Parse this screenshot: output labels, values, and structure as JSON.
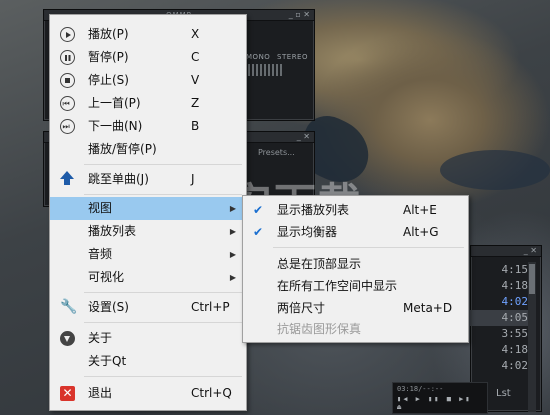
{
  "main_window": {
    "title": "QMMP",
    "mono_label": "MONO",
    "stereo_label": "STEREO"
  },
  "equalizer": {
    "presets_label": "Presets"
  },
  "playlist": {
    "durations": [
      "4:15",
      "4:18",
      "4:02",
      "4:05",
      "3:55",
      "4:18",
      "4:02"
    ],
    "active_index": 2,
    "selected_index": 3,
    "lst_label": "Lst"
  },
  "mini_player": {
    "time": "03:18/--:--",
    "controls": "▮◀ ▶ ▮▮ ■ ▶▮ ⏏"
  },
  "watermark": {
    "text": "安下载"
  },
  "context_menu": {
    "items": [
      {
        "label": "播放(P)",
        "shortcut": "X",
        "icon": "play-icon"
      },
      {
        "label": "暂停(P)",
        "shortcut": "C",
        "icon": "pause-icon"
      },
      {
        "label": "停止(S)",
        "shortcut": "V",
        "icon": "stop-icon"
      },
      {
        "label": "上一首(P)",
        "shortcut": "Z",
        "icon": "previous-icon"
      },
      {
        "label": "下一曲(N)",
        "shortcut": "B",
        "icon": "next-icon"
      },
      {
        "label": "播放/暂停(P)",
        "shortcut": "",
        "icon": ""
      },
      {
        "label": "跳至单曲(J)",
        "shortcut": "J",
        "icon": "jump-arrow-icon"
      },
      {
        "label": "视图",
        "shortcut": "",
        "icon": "",
        "submenu": true
      },
      {
        "label": "播放列表",
        "shortcut": "",
        "icon": "",
        "submenu": true
      },
      {
        "label": "音频",
        "shortcut": "",
        "icon": "",
        "submenu": true
      },
      {
        "label": "可视化",
        "shortcut": "",
        "icon": "",
        "submenu": true
      },
      {
        "label": "设置(S)",
        "shortcut": "Ctrl+P",
        "icon": "wrench-icon"
      },
      {
        "label": "关于",
        "shortcut": "",
        "icon": "qmmp-icon"
      },
      {
        "label": "关于Qt",
        "shortcut": "",
        "icon": ""
      },
      {
        "label": "退出",
        "shortcut": "Ctrl+Q",
        "icon": "exit-icon"
      }
    ]
  },
  "view_submenu": {
    "items": [
      {
        "label": "显示播放列表",
        "shortcut": "Alt+E",
        "checked": true
      },
      {
        "label": "显示均衡器",
        "shortcut": "Alt+G",
        "checked": true
      },
      {
        "label": "总是在顶部显示",
        "shortcut": "",
        "checked": false
      },
      {
        "label": "在所有工作空间中显示",
        "shortcut": "",
        "checked": false
      },
      {
        "label": "两倍尺寸",
        "shortcut": "Meta+D",
        "checked": false
      },
      {
        "label": "抗锯齿图形保真",
        "shortcut": "",
        "checked": false,
        "disabled": true
      }
    ]
  },
  "colors": {
    "menu_bg": "#f0f0f0",
    "highlight": "#99c9ef",
    "player_bg": "#1b1d20",
    "active_track": "#6fa2ff"
  }
}
